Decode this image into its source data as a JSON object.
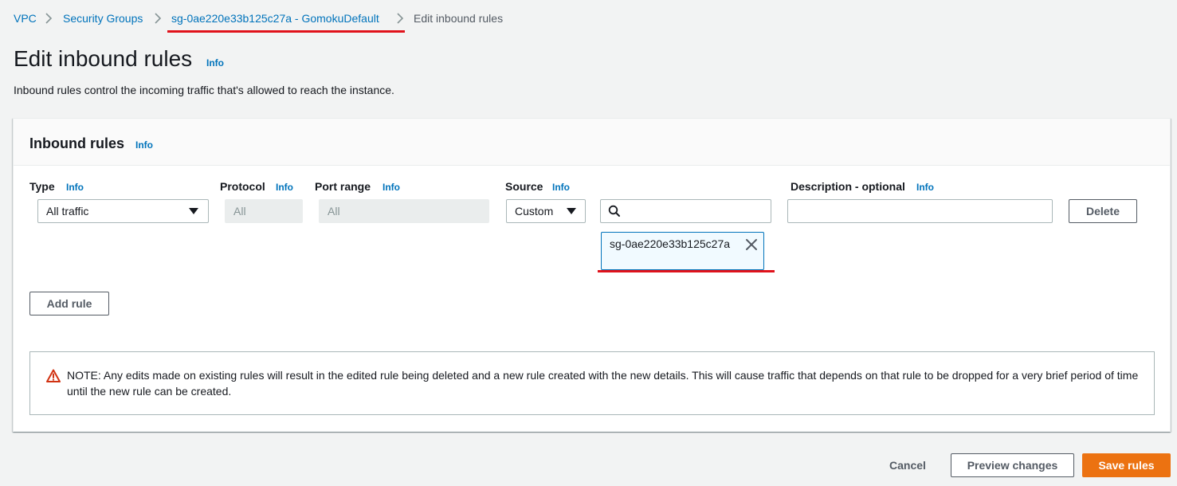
{
  "breadcrumb": {
    "items": [
      {
        "label": "VPC"
      },
      {
        "label": "Security Groups"
      },
      {
        "label": "sg-0ae220e33b125c27a - GomokuDefault"
      },
      {
        "label": "Edit inbound rules"
      }
    ]
  },
  "header": {
    "title": "Edit inbound rules",
    "info": "Info",
    "description": "Inbound rules control the incoming traffic that's allowed to reach the instance."
  },
  "inbound_rules": {
    "title": "Inbound rules",
    "info": "Info",
    "columns": {
      "type": {
        "label": "Type",
        "info": "Info"
      },
      "protocol": {
        "label": "Protocol",
        "info": "Info"
      },
      "port_range": {
        "label": "Port range",
        "info": "Info"
      },
      "source": {
        "label": "Source",
        "info": "Info"
      },
      "description": {
        "label": "Description - optional",
        "info": "Info"
      }
    },
    "rule": {
      "type_value": "All traffic",
      "protocol_value": "All",
      "port_range_value": "All",
      "source_value": "Custom",
      "search_value": "",
      "description_value": "",
      "delete_label": "Delete",
      "source_token": "sg-0ae220e33b125c27a"
    },
    "add_rule_label": "Add rule",
    "alert_text": "NOTE: Any edits made on existing rules will result in the edited rule being deleted and a new rule created with the new details. This will cause traffic that depends on that rule to be dropped for a very brief period of time until the new rule can be created."
  },
  "footer": {
    "cancel_label": "Cancel",
    "preview_label": "Preview changes",
    "save_label": "Save rules"
  },
  "colors": {
    "link": "#0073bb",
    "primary_button": "#ec7211",
    "annotation_underline": "#e0121b",
    "warning_icon": "#d13212"
  }
}
